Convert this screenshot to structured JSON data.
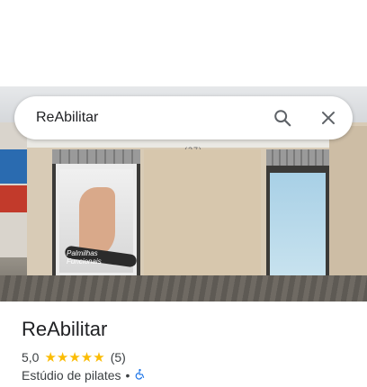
{
  "search": {
    "value": "ReAbilitar"
  },
  "photo": {
    "window_caption": "Palmilhas Funcionais",
    "top_label": "(27)"
  },
  "place": {
    "name": "ReAbilitar",
    "rating": "5,0",
    "stars": "★★★★★",
    "review_count": "(5)",
    "category": "Estúdio de pilates",
    "separator": "•"
  },
  "icons": {
    "search": "search-icon",
    "close": "close-icon",
    "accessibility": "wheelchair-accessible-icon"
  },
  "colors": {
    "star": "#fbbc04",
    "accessibility": "#1a73e8",
    "text": "#202124"
  }
}
